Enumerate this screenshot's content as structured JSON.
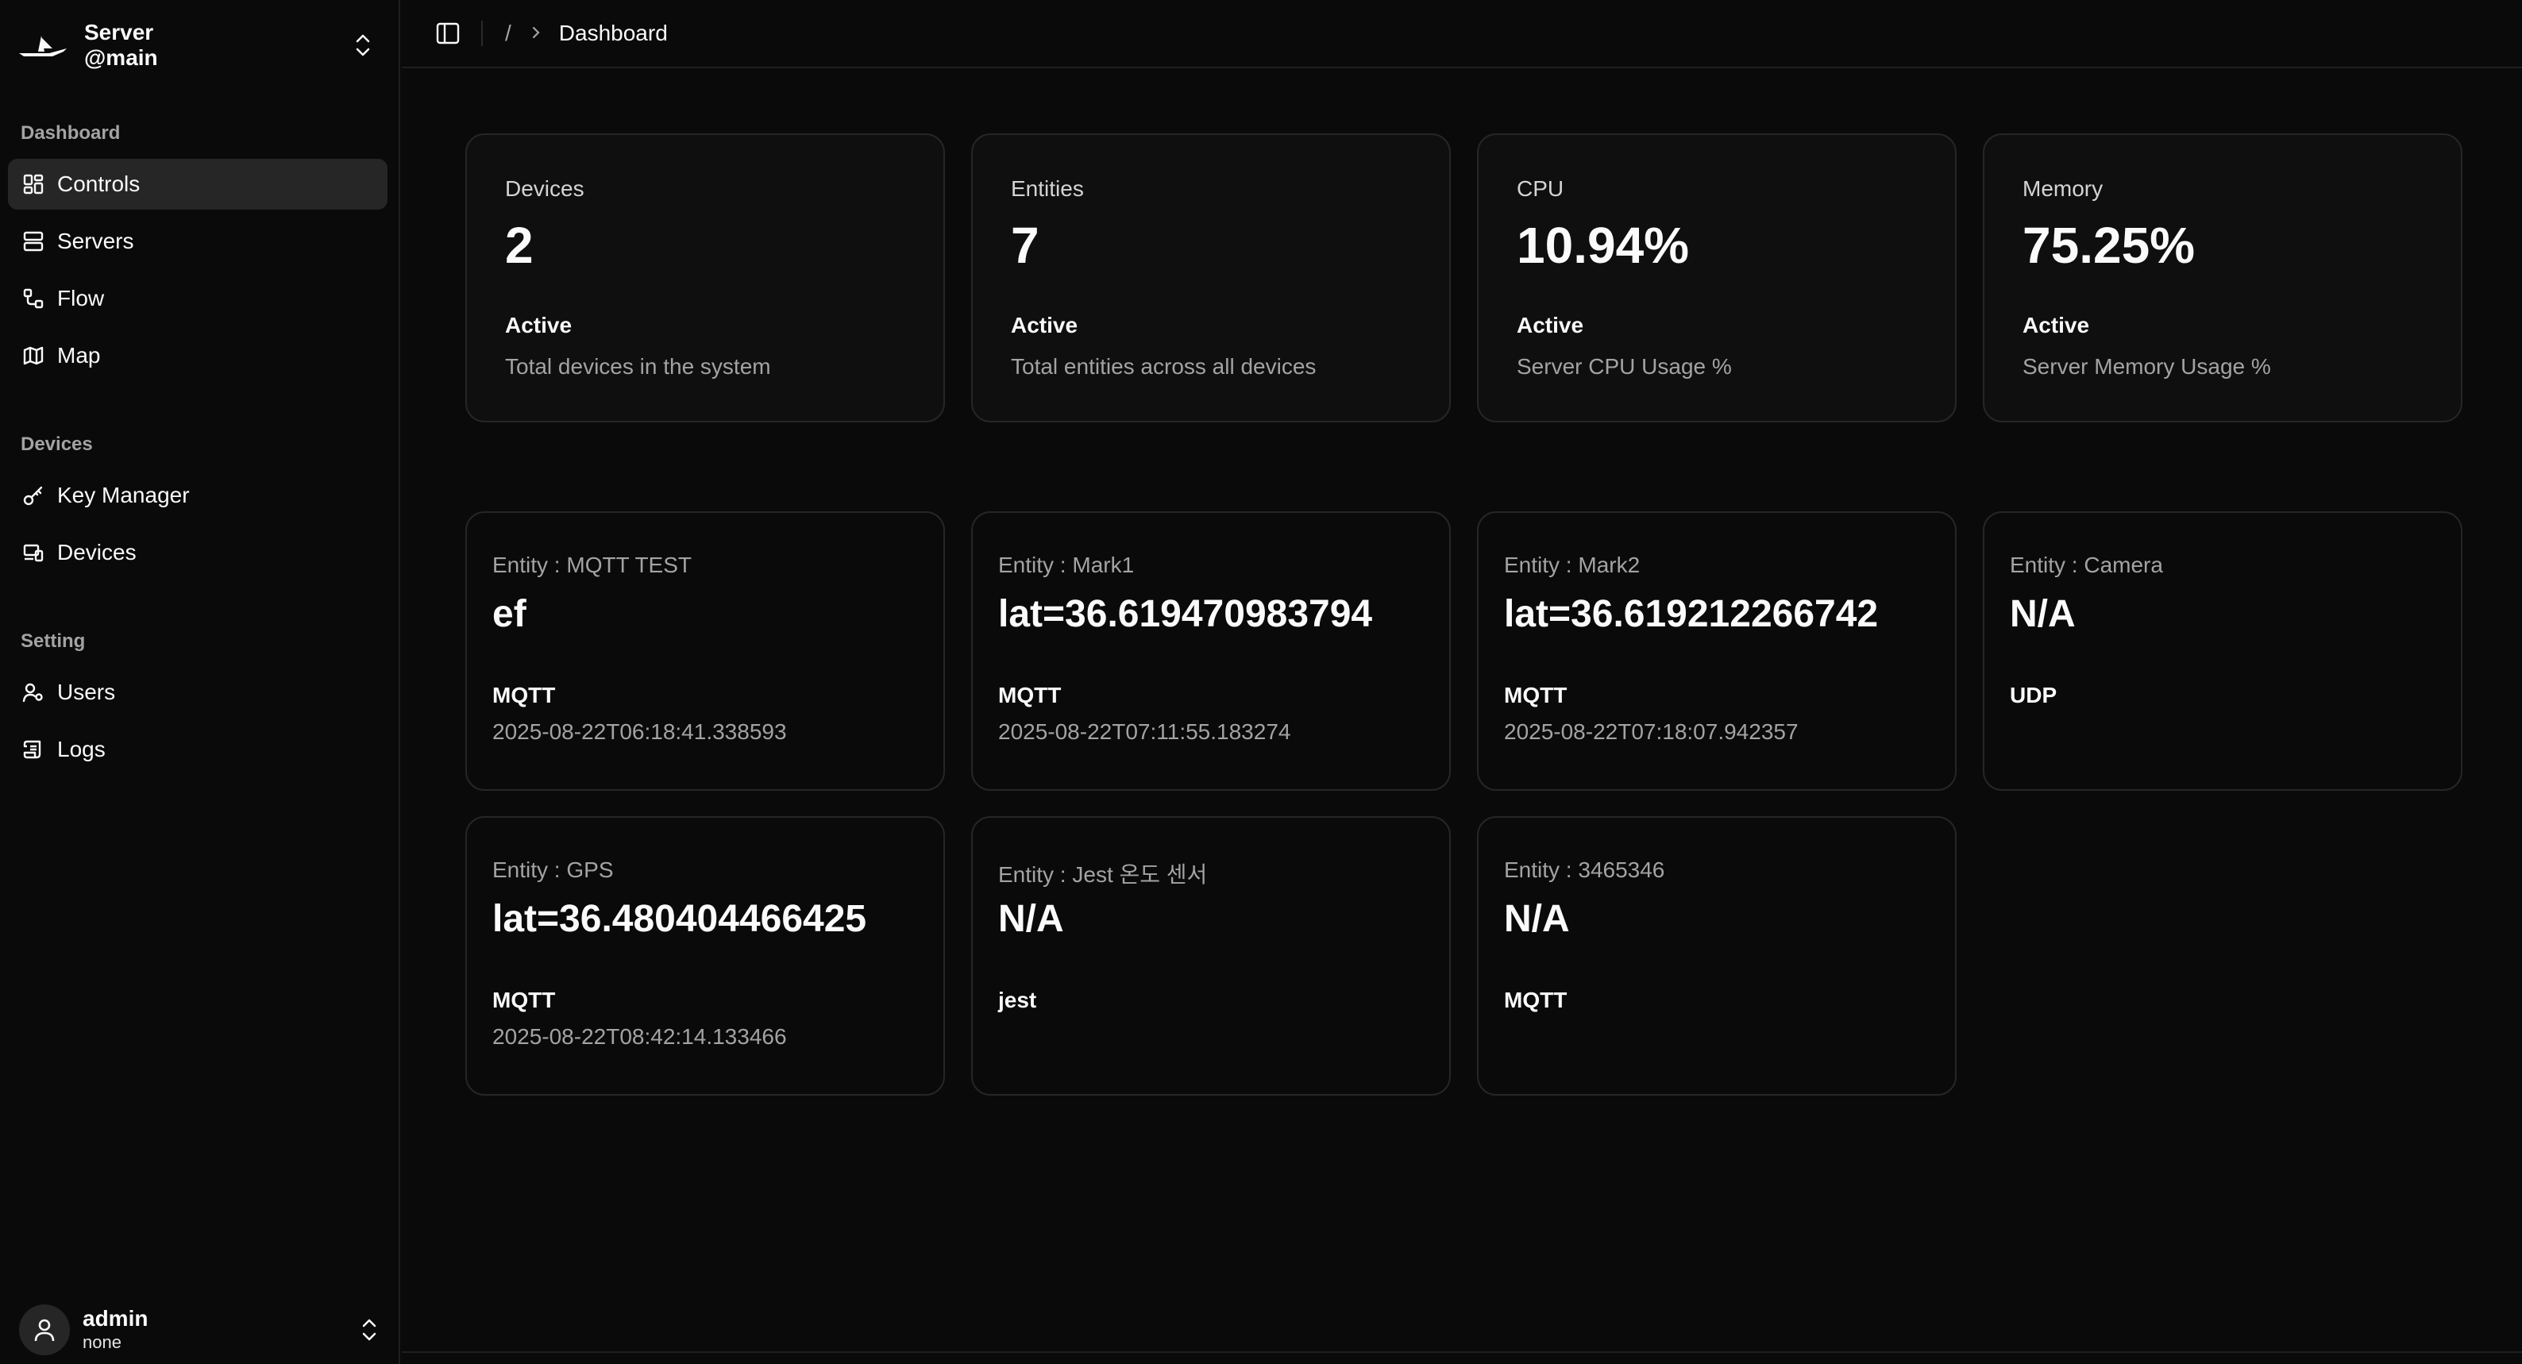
{
  "brand": {
    "name": "Server",
    "branch": "@main"
  },
  "sidebar": {
    "groups": [
      {
        "label": "Dashboard"
      },
      {
        "label": "Devices"
      },
      {
        "label": "Setting"
      }
    ],
    "items": [
      {
        "label": "Controls",
        "icon": "grid-icon"
      },
      {
        "label": "Servers",
        "icon": "server-icon"
      },
      {
        "label": "Flow",
        "icon": "flow-icon"
      },
      {
        "label": "Map",
        "icon": "map-icon"
      },
      {
        "label": "Key Manager",
        "icon": "key-icon"
      },
      {
        "label": "Devices",
        "icon": "devices-icon"
      },
      {
        "label": "Users",
        "icon": "users-icon"
      },
      {
        "label": "Logs",
        "icon": "logs-icon"
      }
    ]
  },
  "user": {
    "name": "admin",
    "role": "none"
  },
  "header": {
    "slash": "/",
    "current": "Dashboard"
  },
  "stats": [
    {
      "title": "Devices",
      "value": "2",
      "status": "Active",
      "desc": "Total devices in the system"
    },
    {
      "title": "Entities",
      "value": "7",
      "status": "Active",
      "desc": "Total entities across all devices"
    },
    {
      "title": "CPU",
      "value": "10.94%",
      "status": "Active",
      "desc": "Server CPU Usage %"
    },
    {
      "title": "Memory",
      "value": "75.25%",
      "status": "Active",
      "desc": "Server Memory Usage %"
    }
  ],
  "entities": [
    {
      "title": "Entity : MQTT TEST",
      "value": "ef",
      "protocol": "MQTT",
      "time": "2025-08-22T06:18:41.338593"
    },
    {
      "title": "Entity : Mark1",
      "value": "lat=36.619470983794",
      "protocol": "MQTT",
      "time": "2025-08-22T07:11:55.183274"
    },
    {
      "title": "Entity : Mark2",
      "value": "lat=36.619212266742",
      "protocol": "MQTT",
      "time": "2025-08-22T07:18:07.942357"
    },
    {
      "title": "Entity : Camera",
      "value": "N/A",
      "protocol": "UDP",
      "time": ""
    },
    {
      "title": "Entity : GPS",
      "value": "lat=36.480404466425",
      "protocol": "MQTT",
      "time": "2025-08-22T08:42:14.133466"
    },
    {
      "title": "Entity : Jest 온도 센서",
      "value": "N/A",
      "protocol": "jest",
      "time": ""
    },
    {
      "title": "Entity : 3465346",
      "value": "N/A",
      "protocol": "MQTT",
      "time": ""
    }
  ]
}
